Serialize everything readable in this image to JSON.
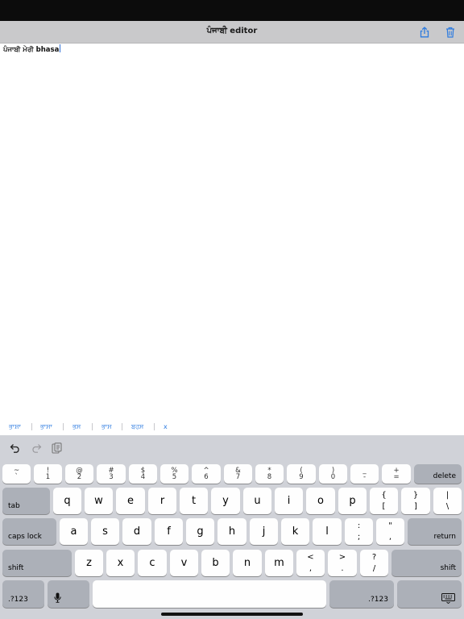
{
  "nav": {
    "title": "ਪੰਜਾਬੀ editor",
    "share_icon": "share-icon",
    "delete_icon": "trash-icon"
  },
  "editor": {
    "text": "ਪੰਜਾਬੀ ਮੇਰੀ bhasa"
  },
  "suggestions": [
    "ਭਾਸ਼ਾ",
    "ਭਾਸਾ",
    "ਭਸ",
    "ਭਾਸ",
    "ਬਹਸ",
    "x"
  ],
  "kb_toolbar": {
    "icons": [
      "undo-icon",
      "redo-icon",
      "paste-icon"
    ]
  },
  "row1": [
    {
      "top": "~",
      "bottom": "`"
    },
    {
      "top": "!",
      "bottom": "1"
    },
    {
      "top": "@",
      "bottom": "2"
    },
    {
      "top": "#",
      "bottom": "3"
    },
    {
      "top": "$",
      "bottom": "4"
    },
    {
      "top": "%",
      "bottom": "5"
    },
    {
      "top": "^",
      "bottom": "6"
    },
    {
      "top": "&",
      "bottom": "7"
    },
    {
      "top": "*",
      "bottom": "8"
    },
    {
      "top": "(",
      "bottom": "9"
    },
    {
      "top": ")",
      "bottom": "0"
    },
    {
      "top": "_",
      "bottom": "-"
    },
    {
      "top": "+",
      "bottom": "="
    }
  ],
  "delete_label": "delete",
  "tab_label": "tab",
  "row2": [
    "q",
    "w",
    "e",
    "r",
    "t",
    "y",
    "u",
    "i",
    "o",
    "p"
  ],
  "row2_syms": [
    {
      "top": "{",
      "bottom": "["
    },
    {
      "top": "}",
      "bottom": "]"
    },
    {
      "top": "|",
      "bottom": "\\"
    }
  ],
  "caps_label": "caps lock",
  "row3": [
    "a",
    "s",
    "d",
    "f",
    "g",
    "h",
    "j",
    "k",
    "l"
  ],
  "row3_syms": [
    {
      "top": ":",
      "bottom": ";"
    },
    {
      "top": "\"",
      "bottom": ","
    }
  ],
  "return_label": "return",
  "shift_label": "shift",
  "row4": [
    "z",
    "x",
    "c",
    "v",
    "b",
    "n",
    "m"
  ],
  "row4_syms": [
    {
      "top": "<",
      "bottom": ","
    },
    {
      "top": ">",
      "bottom": "."
    },
    {
      "top": "?",
      "bottom": "/"
    }
  ],
  "numbers_label": ".?123",
  "mic_icon": "microphone-icon",
  "dismiss_icon": "keyboard-dismiss-icon"
}
